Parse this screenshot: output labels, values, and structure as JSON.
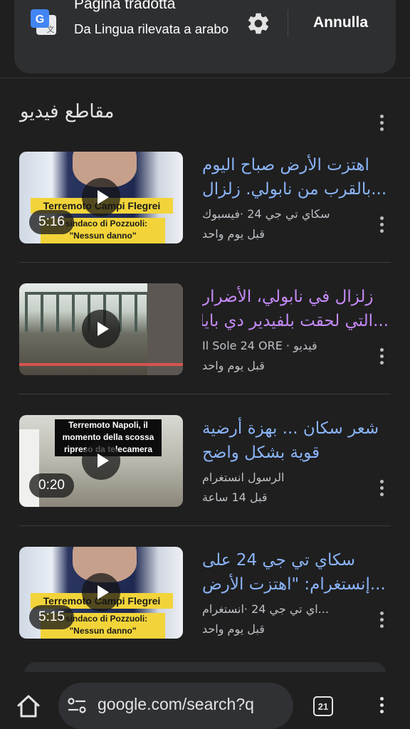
{
  "translate_bar": {
    "title": "Pagina tradotta",
    "subtitle": "Da Lingua rilevata a arabo",
    "cancel_label": "Annulla",
    "icons": [
      "google-translate-icon",
      "gear-icon"
    ]
  },
  "section": {
    "title": "مقاطع فيديو"
  },
  "videos": [
    {
      "title_line1": "اهتزت الأرض صباح اليوم",
      "title_line2": "...بالقرب من نابولي. زلزال",
      "source": "سكاي تي جي 24 ·فيسبوك",
      "time": "قبل يوم واحد",
      "duration": "5:16",
      "thumb_text_1": "Terremoto Campi Flegrei",
      "thumb_text_2": "Il sindaco di Pozzuoli: \"Nessun danno\"",
      "visited": false
    },
    {
      "title_line1": "زلزال في نابولي، الأضرار",
      "title_line2": "...التي لحقت بلفيدير دي بايا",
      "source": "فيديو · Il Sole 24 ORE",
      "time": "قبل يوم واحد",
      "duration": "",
      "visited": true
    },
    {
      "title_line1": "شعر سكان ... بهزة أرضية",
      "title_line2": "قوية بشكل واضح",
      "source": "الرسول انستغرام",
      "time": "قبل 14 ساعة",
      "duration": "0:20",
      "thumb_text_1": "Terremoto Napoli, il momento della scossa ripreso da telecamera",
      "visited": false
    },
    {
      "title_line1": "سكاي تي جي 24 على",
      "title_line2": "...إنستغرام: \"اهتزت الأرض",
      "source": "...اي تي جي 24 ·انستغرام",
      "time": "قبل يوم واحد",
      "duration": "5:15",
      "thumb_text_1": "Terremoto Campi Flegrei",
      "thumb_text_2": "Il sindaco di Pozzuoli: \"Nessun danno\"",
      "visited": false
    }
  ],
  "bottom_bar": {
    "url": "google.com/search?q",
    "tab_count": "21"
  },
  "colors": {
    "background": "#1f1f1f",
    "link": "#8ab4f8",
    "visited_link": "#c58af9",
    "meta_text": "#bdc1c6"
  }
}
